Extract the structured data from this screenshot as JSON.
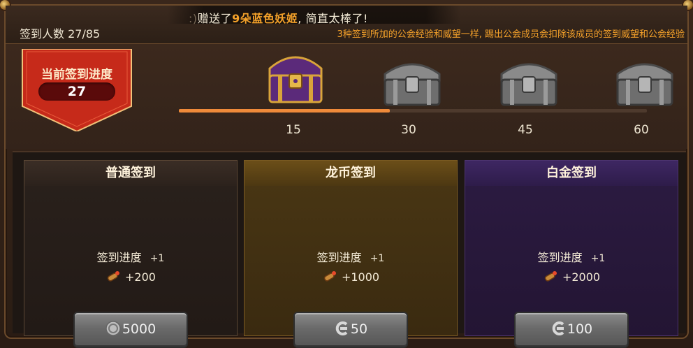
{
  "header": {
    "marquee_prefix": ":)",
    "marquee_text_1": "赠送了",
    "marquee_highlight": "9朵蓝色妖姬",
    "marquee_text_2": ", 简直太棒了!",
    "checkin_count": "签到人数 27/85",
    "notice": "3种签到所加的公会经验和威望一样, 踢出公会成员会扣除该成员的签到威望和公会经验"
  },
  "progress": {
    "title": "当前签到进度",
    "value": "27",
    "fill_percent": 45,
    "milestones": [
      "15",
      "30",
      "45",
      "60"
    ]
  },
  "cards": [
    {
      "title": "普通签到",
      "progress_label": "签到进度",
      "progress_plus": "+1",
      "reward": "+200",
      "cost": "5000",
      "cost_icon": "silver-coin-icon"
    },
    {
      "title": "龙币签到",
      "progress_label": "签到进度",
      "progress_plus": "+1",
      "reward": "+1000",
      "cost": "50",
      "cost_icon": "dragon-coin-icon"
    },
    {
      "title": "白金签到",
      "progress_label": "签到进度",
      "progress_plus": "+1",
      "reward": "+2000",
      "cost": "100",
      "cost_icon": "dragon-coin-icon"
    }
  ],
  "colors": {
    "accent_orange": "#f4a12a",
    "progress_fill": "#ef8a3a",
    "banner_red": "#c62a1a"
  }
}
